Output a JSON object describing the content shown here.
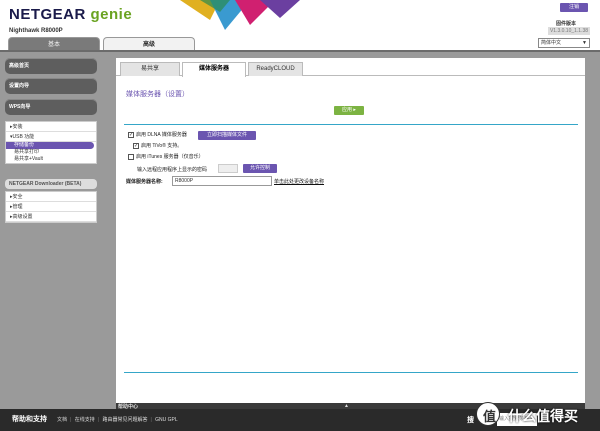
{
  "header": {
    "brand_netgear": "NETGEAR",
    "brand_genie": "genie",
    "model": "Nighthawk R8000P",
    "logout_label": "注销",
    "firmware_label": "固件版本",
    "firmware_version": "V1.3.0.10_1.1.38",
    "language": "简体中文"
  },
  "top_tabs": {
    "basic": "基本",
    "advanced": "高级"
  },
  "sidebar": {
    "home": "高级首页",
    "setup_wizard": "设置向导",
    "wps_wizard": "WPS向导",
    "menu1": [
      "▸安装",
      "▾USB 功能"
    ],
    "usb_sub": [
      "存储备份",
      "易共享打印",
      "易共享+Vault"
    ],
    "downloader": "NETGEAR Downloader (BETA)",
    "menu2": [
      "▸安全",
      "▸管理",
      "▸高级设置"
    ]
  },
  "content": {
    "tabs": [
      "易共享",
      "媒体服务器",
      "ReadyCLOUD"
    ],
    "page_title": "媒体服务器（设置）",
    "apply_label": "应用 ▸",
    "dlna_label": "启用 DLNA 媒体服务器",
    "rescan_label": "立即扫描媒体文件",
    "tivo_label": "启用 TiVo® 支持。",
    "itunes_label": "启用 iTunes 服务器（仅音乐）",
    "passcode_label": "输入远程应用程序上显示的密码",
    "allow_control_label": "允许控制",
    "server_name_label": "媒体服务器名称:",
    "server_name_value": "R8000P",
    "change_link": "单击此处更改设备名称"
  },
  "bottom": {
    "help_title": "帮助和支持",
    "help_links": [
      "文档",
      "在线支持",
      "路由器常见问题解答",
      "GNU GPL"
    ],
    "help_peek": "帮助中心",
    "search_label": "搜",
    "search_placeholder": "输入搜索条目"
  },
  "watermark": {
    "text": "什么值得买",
    "badge": "值"
  },
  "colors": {
    "accent": "#6b55b0",
    "apply": "#7cb342",
    "rule": "#35a6c8"
  }
}
